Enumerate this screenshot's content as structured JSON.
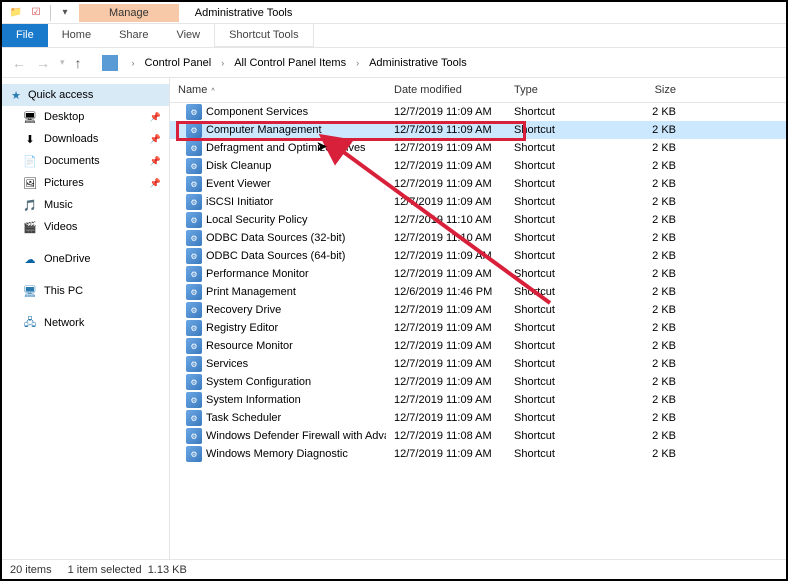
{
  "titlebar": {
    "context_tab": "Manage",
    "window_title": "Administrative Tools"
  },
  "ribbon": {
    "file": "File",
    "home": "Home",
    "share": "Share",
    "view": "View",
    "shortcut_tools": "Shortcut Tools"
  },
  "breadcrumb": {
    "parts": [
      "Control Panel",
      "All Control Panel Items",
      "Administrative Tools"
    ]
  },
  "sidebar": {
    "quick_access": "Quick access",
    "items": [
      {
        "icon": "desktop-icon",
        "glyph": "🖥",
        "label": "Desktop",
        "pinned": true
      },
      {
        "icon": "downloads-icon",
        "glyph": "⬇",
        "label": "Downloads",
        "pinned": true
      },
      {
        "icon": "documents-icon",
        "glyph": "📄",
        "label": "Documents",
        "pinned": true
      },
      {
        "icon": "pictures-icon",
        "glyph": "🖼",
        "label": "Pictures",
        "pinned": true
      },
      {
        "icon": "music-icon",
        "glyph": "🎵",
        "label": "Music",
        "pinned": false
      },
      {
        "icon": "videos-icon",
        "glyph": "🎬",
        "label": "Videos",
        "pinned": false
      }
    ],
    "onedrive": "OneDrive",
    "this_pc": "This PC",
    "network": "Network"
  },
  "columns": {
    "name": "Name",
    "date": "Date modified",
    "type": "Type",
    "size": "Size"
  },
  "rows": [
    {
      "name": "Component Services",
      "date": "12/7/2019 11:09 AM",
      "type": "Shortcut",
      "size": "2 KB",
      "selected": false
    },
    {
      "name": "Computer Management",
      "date": "12/7/2019 11:09 AM",
      "type": "Shortcut",
      "size": "2 KB",
      "selected": true
    },
    {
      "name": "Defragment and Optimize Drives",
      "date": "12/7/2019 11:09 AM",
      "type": "Shortcut",
      "size": "2 KB",
      "selected": false
    },
    {
      "name": "Disk Cleanup",
      "date": "12/7/2019 11:09 AM",
      "type": "Shortcut",
      "size": "2 KB",
      "selected": false
    },
    {
      "name": "Event Viewer",
      "date": "12/7/2019 11:09 AM",
      "type": "Shortcut",
      "size": "2 KB",
      "selected": false
    },
    {
      "name": "iSCSI Initiator",
      "date": "12/7/2019 11:09 AM",
      "type": "Shortcut",
      "size": "2 KB",
      "selected": false
    },
    {
      "name": "Local Security Policy",
      "date": "12/7/2019 11:10 AM",
      "type": "Shortcut",
      "size": "2 KB",
      "selected": false
    },
    {
      "name": "ODBC Data Sources (32-bit)",
      "date": "12/7/2019 11:10 AM",
      "type": "Shortcut",
      "size": "2 KB",
      "selected": false
    },
    {
      "name": "ODBC Data Sources (64-bit)",
      "date": "12/7/2019 11:09 AM",
      "type": "Shortcut",
      "size": "2 KB",
      "selected": false
    },
    {
      "name": "Performance Monitor",
      "date": "12/7/2019 11:09 AM",
      "type": "Shortcut",
      "size": "2 KB",
      "selected": false
    },
    {
      "name": "Print Management",
      "date": "12/6/2019 11:46 PM",
      "type": "Shortcut",
      "size": "2 KB",
      "selected": false
    },
    {
      "name": "Recovery Drive",
      "date": "12/7/2019 11:09 AM",
      "type": "Shortcut",
      "size": "2 KB",
      "selected": false
    },
    {
      "name": "Registry Editor",
      "date": "12/7/2019 11:09 AM",
      "type": "Shortcut",
      "size": "2 KB",
      "selected": false
    },
    {
      "name": "Resource Monitor",
      "date": "12/7/2019 11:09 AM",
      "type": "Shortcut",
      "size": "2 KB",
      "selected": false
    },
    {
      "name": "Services",
      "date": "12/7/2019 11:09 AM",
      "type": "Shortcut",
      "size": "2 KB",
      "selected": false
    },
    {
      "name": "System Configuration",
      "date": "12/7/2019 11:09 AM",
      "type": "Shortcut",
      "size": "2 KB",
      "selected": false
    },
    {
      "name": "System Information",
      "date": "12/7/2019 11:09 AM",
      "type": "Shortcut",
      "size": "2 KB",
      "selected": false
    },
    {
      "name": "Task Scheduler",
      "date": "12/7/2019 11:09 AM",
      "type": "Shortcut",
      "size": "2 KB",
      "selected": false
    },
    {
      "name": "Windows Defender Firewall with Advanc...",
      "date": "12/7/2019 11:08 AM",
      "type": "Shortcut",
      "size": "2 KB",
      "selected": false
    },
    {
      "name": "Windows Memory Diagnostic",
      "date": "12/7/2019 11:09 AM",
      "type": "Shortcut",
      "size": "2 KB",
      "selected": false
    }
  ],
  "status": {
    "count": "20 items",
    "selected": "1 item selected",
    "size": "1.13 KB"
  }
}
